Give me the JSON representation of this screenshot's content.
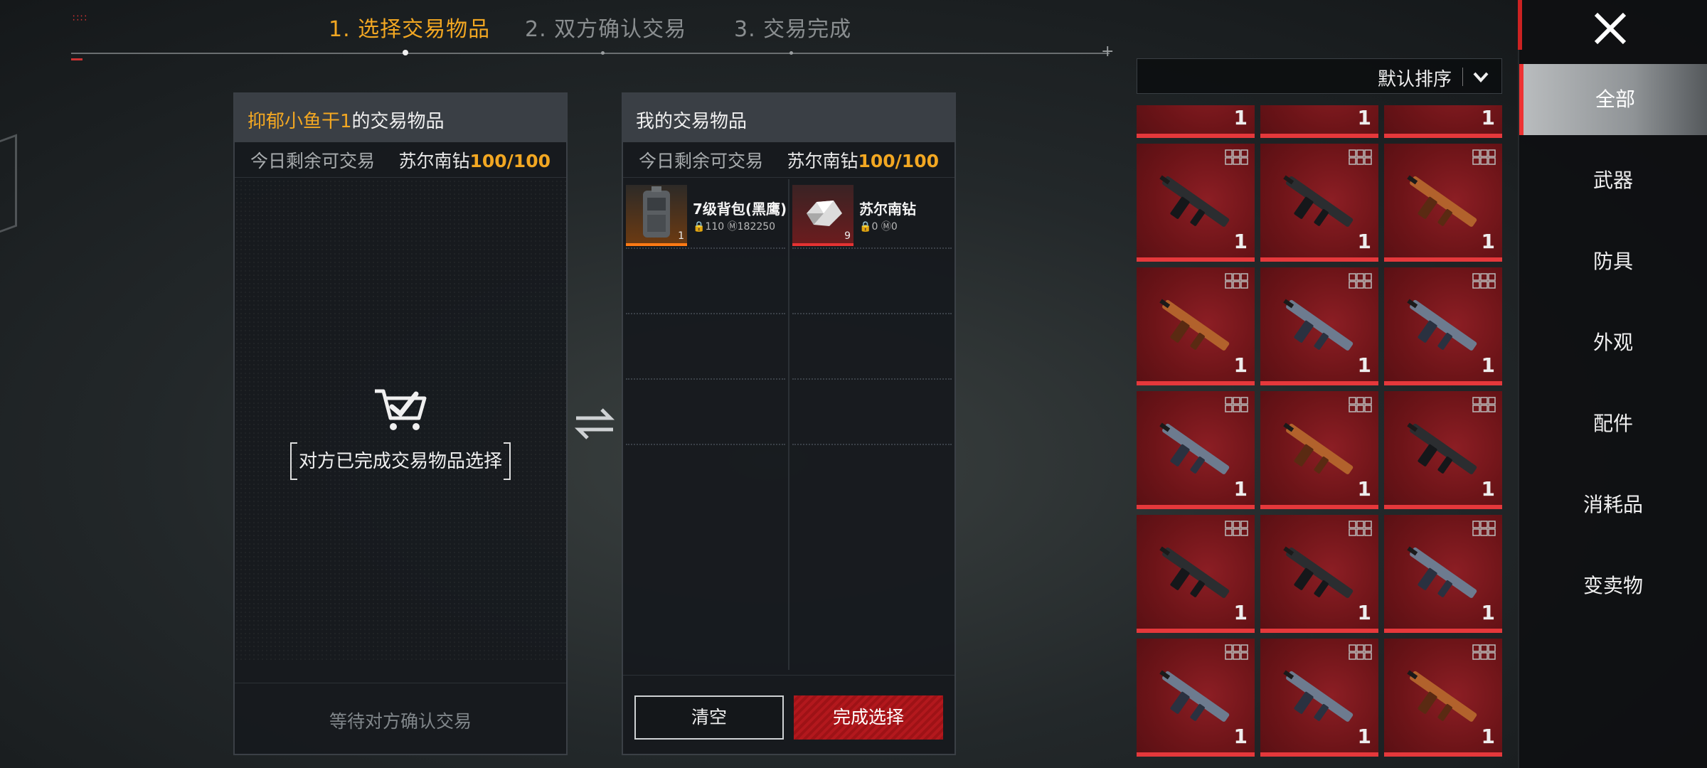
{
  "steps": {
    "step1": "1. 选择交易物品",
    "step2": "2. 双方确认交易",
    "step3": "3. 交易完成"
  },
  "left_panel": {
    "owner": "抑郁小鱼干1",
    "title_suffix": "的交易物品",
    "quota_label": "今日剩余可交易",
    "quota_item": "苏尔南钻",
    "quota_value": "100/100",
    "status_text": "对方已完成交易物品选择",
    "footer_text": "等待对方确认交易"
  },
  "right_panel": {
    "title": "我的交易物品",
    "quota_label": "今日剩余可交易",
    "quota_item": "苏尔南钻",
    "quota_value": "100/100",
    "items": [
      {
        "name": "7级背包(黑鹰)",
        "qty": "1",
        "lock_value": "110",
        "m_value": "182250",
        "rarity_color": "#ff7a14"
      },
      {
        "name": "苏尔南钻",
        "qty": "9",
        "lock_value": "0",
        "m_value": "0",
        "rarity_color": "#e43232"
      }
    ],
    "clear_button": "清空",
    "done_button": "完成选择"
  },
  "inventory": {
    "sort_label": "默认排序",
    "cells": [
      {
        "qty": "1",
        "skin": "dark"
      },
      {
        "qty": "1",
        "skin": "dark"
      },
      {
        "qty": "1",
        "skin": "dark"
      },
      {
        "qty": "1",
        "skin": "dark"
      },
      {
        "qty": "1",
        "skin": "dark"
      },
      {
        "qty": "1",
        "skin": "orange"
      },
      {
        "qty": "1",
        "skin": "orange"
      },
      {
        "qty": "1",
        "skin": "blue"
      },
      {
        "qty": "1",
        "skin": "blue"
      },
      {
        "qty": "1",
        "skin": "blue"
      },
      {
        "qty": "1",
        "skin": "orange"
      },
      {
        "qty": "1",
        "skin": "dark"
      },
      {
        "qty": "1",
        "skin": "dark"
      },
      {
        "qty": "1",
        "skin": "dark"
      },
      {
        "qty": "1",
        "skin": "blue"
      },
      {
        "qty": "1",
        "skin": "blue"
      },
      {
        "qty": "1",
        "skin": "blue"
      },
      {
        "qty": "1",
        "skin": "orange"
      }
    ]
  },
  "sidebar": {
    "items": [
      "全部",
      "武器",
      "防具",
      "外观",
      "配件",
      "消耗品",
      "变卖物"
    ],
    "active_index": 0
  },
  "colors": {
    "accent": "#f2a722",
    "danger": "#b3181d",
    "cell_red": "#6d1418"
  }
}
